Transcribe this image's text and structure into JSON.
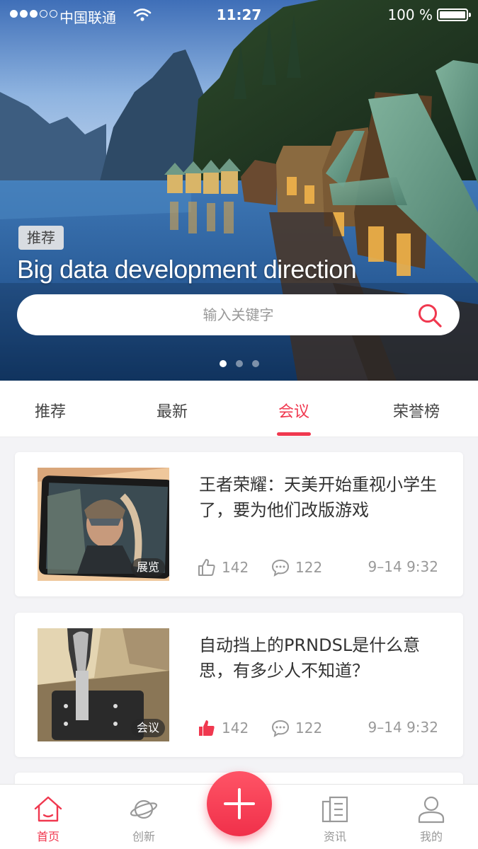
{
  "status_bar": {
    "carrier": "中国联通",
    "time": "11:27",
    "battery": "100 %"
  },
  "hero": {
    "badge": "推荐",
    "title": "Big data development direction",
    "search_placeholder": "输入关键字",
    "slide_count": 3,
    "active_slide": 0
  },
  "tabs": [
    {
      "label": "推荐",
      "active": false
    },
    {
      "label": "最新",
      "active": false
    },
    {
      "label": "会议",
      "active": true
    },
    {
      "label": "荣誉榜",
      "active": false
    }
  ],
  "articles": [
    {
      "title": "王者荣耀：天美开始重视小学生了，要为他们改版游戏",
      "tag": "展览",
      "likes": "142",
      "liked": false,
      "comments": "122",
      "date": "9–14 9:32"
    },
    {
      "title": "自动挡上的PRNDSL是什么意思，有多少人不知道？",
      "tag": "会议",
      "likes": "142",
      "liked": true,
      "comments": "122",
      "date": "9–14 9:32"
    }
  ],
  "bottom_nav": [
    {
      "label": "首页",
      "icon": "home-icon",
      "active": true
    },
    {
      "label": "创新",
      "icon": "planet-icon",
      "active": false
    },
    {
      "label": "资讯",
      "icon": "news-icon",
      "active": false
    },
    {
      "label": "我的",
      "icon": "user-icon",
      "active": false
    }
  ],
  "fab_icon": "plus-icon",
  "colors": {
    "accent": "#f0384f",
    "muted_text": "#999999"
  }
}
